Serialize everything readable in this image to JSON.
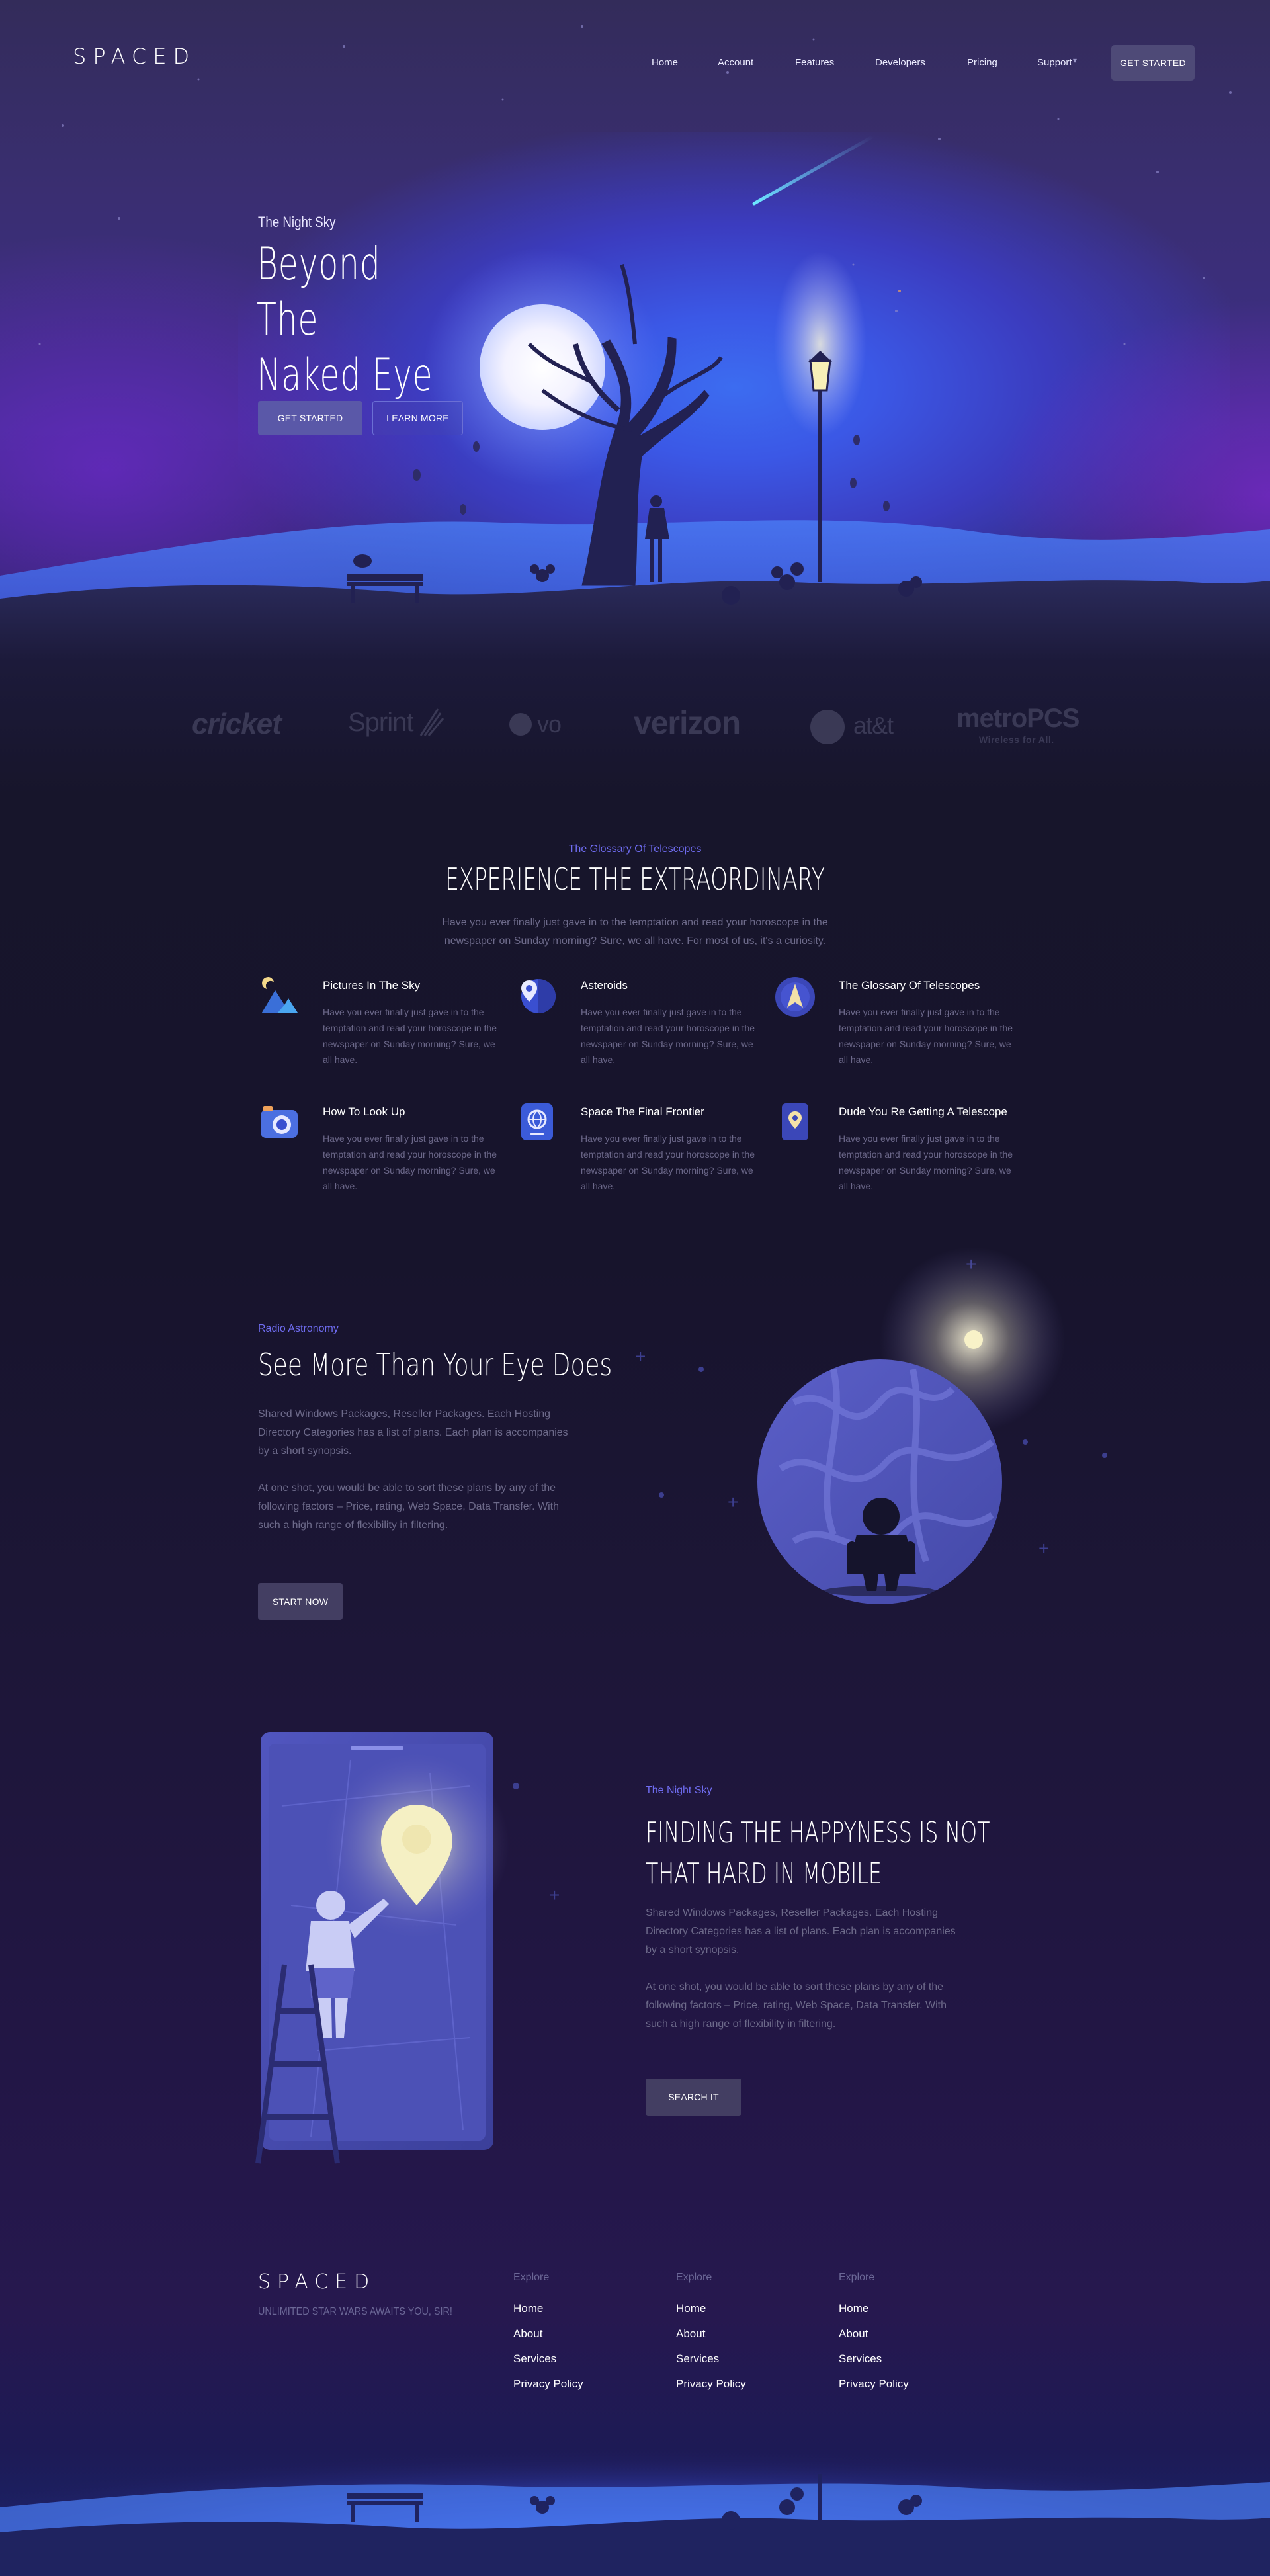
{
  "brand": {
    "logo": "SPACED",
    "tagline": "UNLIMITED STAR WARS AWAITS YOU, SIR!"
  },
  "nav": {
    "items": [
      "Home",
      "Account",
      "Features",
      "Developers",
      "Pricing",
      "Support"
    ],
    "cta": "GET STARTED"
  },
  "hero": {
    "eyebrow": "The Night Sky",
    "title_line1": "Beyond The",
    "title_line2": "Naked Eye",
    "primary_button": "GET STARTED",
    "secondary_button": "LEARN MORE"
  },
  "partners": [
    "cricket",
    "Sprint",
    "vo",
    "verizon",
    "at&t",
    "metroPCS",
    "Wireless for All."
  ],
  "features": {
    "eyebrow": "The Glossary Of Telescopes",
    "title": "EXPERIENCE THE EXTRAORDINARY",
    "description": "Have you ever finally just gave in to the temptation and read your horoscope in the newspaper on Sunday morning? Sure, we all have. For most of us, it's a curiosity.",
    "items": [
      {
        "title": "Pictures In The Sky",
        "text": "Have you ever finally just gave in to the temptation and read your horoscope in the newspaper on Sunday morning? Sure, we all have.",
        "icon": "mountain-moon-icon"
      },
      {
        "title": "Asteroids",
        "text": "Have you ever finally just gave in to the temptation and read your horoscope in the newspaper on Sunday morning? Sure, we all have.",
        "icon": "map-pin-planet-icon"
      },
      {
        "title": "The Glossary Of Telescopes",
        "text": "Have you ever finally just gave in to the temptation and read your horoscope in the newspaper on Sunday morning? Sure, we all have.",
        "icon": "compass-icon"
      },
      {
        "title": "How To Look Up",
        "text": "Have you ever finally just gave in to the temptation and read your horoscope in the newspaper on Sunday morning? Sure, we all have.",
        "icon": "camera-icon"
      },
      {
        "title": "Space The Final Frontier",
        "text": "Have you ever finally just gave in to the temptation and read your horoscope in the newspaper on Sunday morning? Sure, we all have.",
        "icon": "globe-phone-icon"
      },
      {
        "title": "Dude You Re Getting A Telescope",
        "text": "Have you ever finally just gave in to the temptation and read your horoscope in the newspaper on Sunday morning? Sure, we all have.",
        "icon": "map-phone-icon"
      }
    ]
  },
  "radio": {
    "eyebrow": "Radio Astronomy",
    "title": "See More Than Your Eye Does",
    "para1": "Shared Windows Packages, Reseller Packages. Each Hosting Directory Categories has a list of plans. Each plan is accompanies by a short synopsis.",
    "para2": "At one shot, you would be able to sort these plans by any of the following factors – Price, rating, Web Space, Data Transfer. With such a high range of flexibility in filtering.",
    "button": "START NOW"
  },
  "mobile": {
    "eyebrow": "The Night Sky",
    "title_line1": "FINDING THE HAPPYNESS IS NOT",
    "title_line2": "THAT HARD IN MOBILE",
    "para1": "Shared Windows Packages, Reseller Packages. Each Hosting Directory Categories has a list of plans. Each plan is accompanies by a short synopsis.",
    "para2": "At one shot, you would be able to sort these plans by any of the following factors – Price, rating, Web Space, Data Transfer. With such a high range of flexibility in filtering.",
    "button": "SEARCH IT"
  },
  "footer": {
    "columns": [
      {
        "heading": "Explore",
        "links": [
          "Home",
          "About",
          "Services",
          "Privacy Policy"
        ]
      },
      {
        "heading": "Explore",
        "links": [
          "Home",
          "About",
          "Services",
          "Privacy Policy"
        ]
      },
      {
        "heading": "Explore",
        "links": [
          "Home",
          "About",
          "Services",
          "Privacy Policy"
        ]
      }
    ]
  },
  "colors": {
    "accent": "#6f6cf0",
    "button_dark": "#433e62",
    "hero_blue": "#3b58e6",
    "background": "#17152b"
  }
}
